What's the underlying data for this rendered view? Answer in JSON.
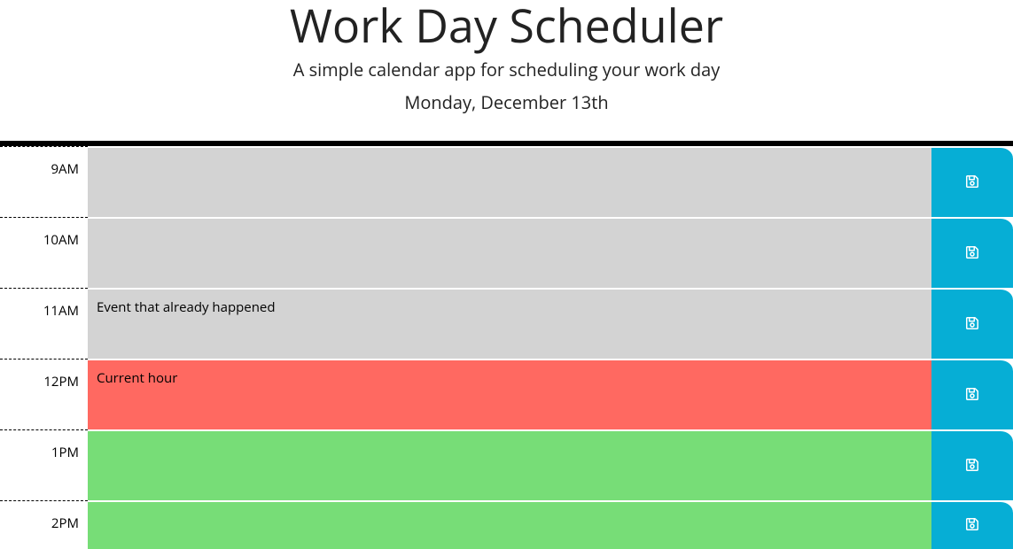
{
  "header": {
    "title": "Work Day Scheduler",
    "lead": "A simple calendar app for scheduling your work day",
    "date": "Monday, December 13th"
  },
  "colors": {
    "past": "#d3d3d3",
    "present": "#ff6961",
    "future": "#77dd77",
    "save": "#06aed5"
  },
  "hours": [
    {
      "label": "9AM",
      "state": "past",
      "value": ""
    },
    {
      "label": "10AM",
      "state": "past",
      "value": ""
    },
    {
      "label": "11AM",
      "state": "past",
      "value": "Event that already happened"
    },
    {
      "label": "12PM",
      "state": "present",
      "value": "Current hour"
    },
    {
      "label": "1PM",
      "state": "future",
      "value": ""
    },
    {
      "label": "2PM",
      "state": "future",
      "value": ""
    }
  ]
}
